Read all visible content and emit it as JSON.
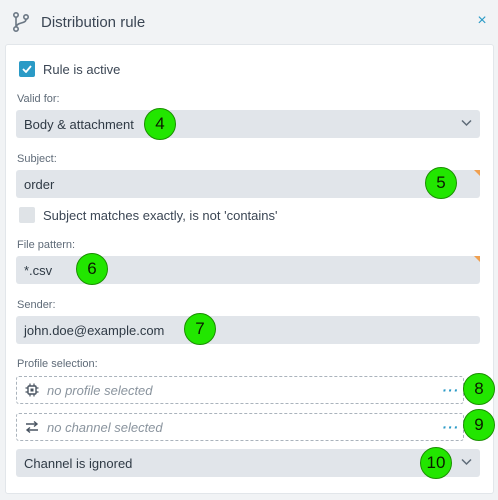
{
  "dialog": {
    "title": "Distribution rule",
    "close_symbol": "×"
  },
  "form": {
    "rule_active": {
      "label": "Rule is active",
      "checked": true
    },
    "valid_for": {
      "label": "Valid for:",
      "value": "Body & attachment"
    },
    "subject": {
      "label": "Subject:",
      "value": "order"
    },
    "subject_exact": {
      "label": "Subject matches exactly, is not 'contains'",
      "checked": false
    },
    "file_pattern": {
      "label": "File pattern:",
      "value": "*.csv"
    },
    "sender": {
      "label": "Sender:",
      "value": "john.doe@example.com"
    },
    "profile_selection": {
      "label": "Profile selection:",
      "profile_placeholder": "no profile selected",
      "channel_placeholder": "no channel selected",
      "more_symbol": "···"
    },
    "channel_mode": {
      "value": "Channel is ignored"
    }
  },
  "badges": [
    "4",
    "5",
    "6",
    "7",
    "8",
    "9",
    "10"
  ],
  "colors": {
    "accent": "#2a9ac6",
    "field_bg": "#e1e5ea",
    "required_marker": "#f0a050",
    "badge_green": "#22e600"
  },
  "icons": {
    "title": "branch-icon",
    "close": "close-icon",
    "profile": "chip-icon",
    "channel": "swap-arrows-icon",
    "dropdown": "chevron-down-icon"
  }
}
